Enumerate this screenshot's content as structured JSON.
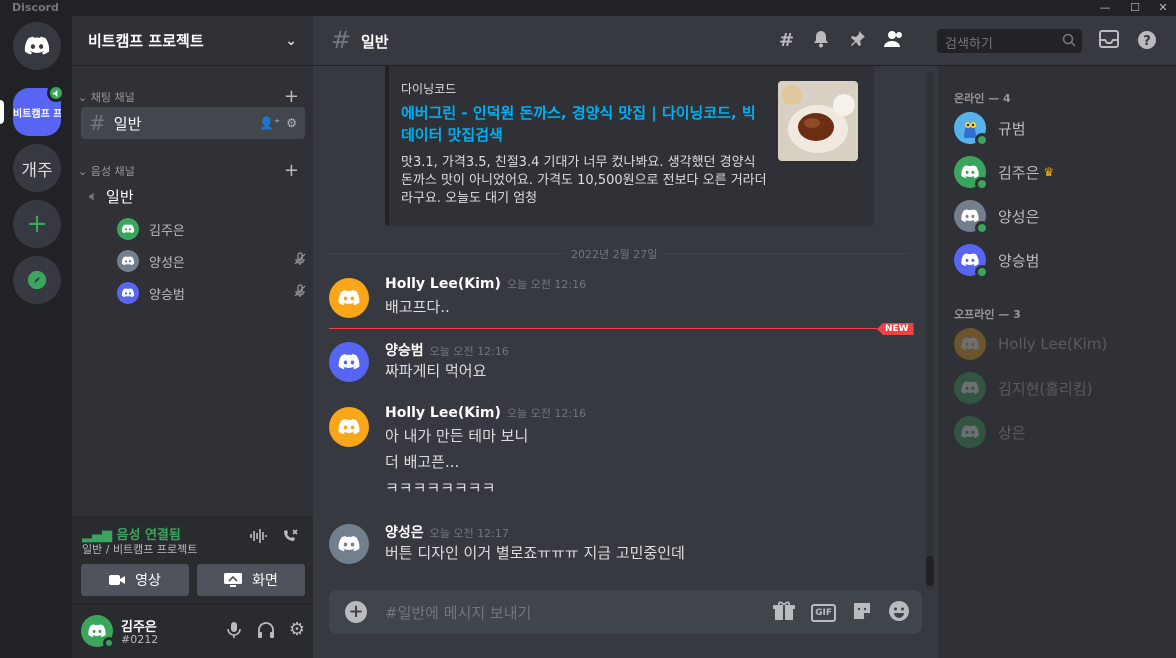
{
  "app": {
    "title": "Discord"
  },
  "colors": {
    "blurple": "#5865f2",
    "green": "#3ba55d",
    "orange": "#faa61a",
    "gray": "#747f8d",
    "red": "#ed4245",
    "link": "#00aff4"
  },
  "servers": {
    "active_name": "비트캠프 프로젝트",
    "active_short": "비트캠프 프로젝트",
    "second": "개주"
  },
  "sidebar": {
    "server_name": "비트캠프 프로젝트",
    "text_category": "채팅 채널",
    "voice_category": "음성 채널",
    "text_channel": "일반",
    "voice_channel": "일반",
    "voice_users": [
      {
        "name": "김주은",
        "color": "#3ba55d",
        "muted": false
      },
      {
        "name": "양성은",
        "color": "#747f8d",
        "muted": true
      },
      {
        "name": "양승범",
        "color": "#5865f2",
        "muted": true
      }
    ]
  },
  "voice_panel": {
    "status": "음성 연결됨",
    "location": "일반 / 비트캠프 프로젝트",
    "video_label": "영상",
    "screen_label": "화면"
  },
  "user_panel": {
    "name": "김주은",
    "tag": "#0212"
  },
  "header": {
    "channel": "일반",
    "search_placeholder": "검색하기"
  },
  "embed": {
    "provider": "다이닝코드",
    "title": "에버그린 - 인덕원 돈까스, 경양식 맛집 | 다이닝코드, 빅데이터 맛집검색",
    "description": "맛3.1, 가격3.5, 친절3.4 기대가 너무 컸나봐요. 생각했던 경양식 돈까스 맛이 아니었어요. 가격도 10,500원으로 전보다 오른 거라더라구요. 오늘도 대기 엄청"
  },
  "date_divider": "2022년 2월 27일",
  "new_badge": "NEW",
  "messages": [
    {
      "author": "Holly Lee(Kim)",
      "time": "오늘 오전 12:16",
      "color": "#faa61a",
      "lines": [
        "배고프다.."
      ]
    },
    {
      "author": "양승범",
      "time": "오늘 오전 12:16",
      "color": "#5865f2",
      "lines": [
        "짜파게티 먹어요"
      ]
    },
    {
      "author": "Holly Lee(Kim)",
      "time": "오늘 오전 12:16",
      "color": "#faa61a",
      "lines": [
        "아 내가 만든 테마 보니",
        "더 배고픈...",
        "ㅋㅋㅋㅋㅋㅋㅋㅋ"
      ]
    },
    {
      "author": "양성은",
      "time": "오늘 오전 12:17",
      "color": "#747f8d",
      "lines": [
        "버튼 디자인 이거 별로죠ㅠㅠㅠ 지금 고민중인데"
      ]
    }
  ],
  "composer": {
    "placeholder": "#일반에 메시지 보내기",
    "gif_label": "GIF"
  },
  "members": {
    "online_label": "온라인 — 4",
    "offline_label": "오프라인 — 3",
    "online": [
      {
        "name": "규범",
        "color": "#5865f2",
        "avatar": "custom"
      },
      {
        "name": "김주은",
        "color": "#3ba55d",
        "owner": true
      },
      {
        "name": "양성은",
        "color": "#747f8d"
      },
      {
        "name": "양승범",
        "color": "#5865f2"
      }
    ],
    "offline": [
      {
        "name": "Holly Lee(Kim)",
        "color": "#faa61a"
      },
      {
        "name": "김지현(홀리킴)",
        "color": "#3ba55d"
      },
      {
        "name": "상은",
        "color": "#3ba55d"
      }
    ]
  }
}
